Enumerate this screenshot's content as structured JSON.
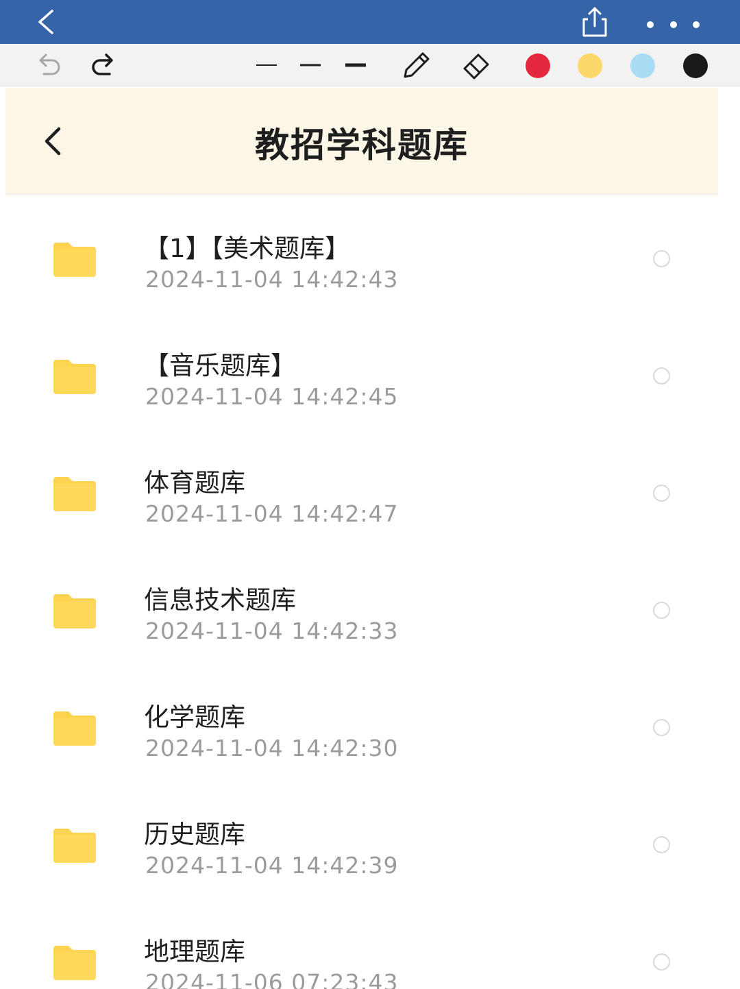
{
  "topbar": {
    "back_icon": "chevron-left-icon",
    "share_icon": "share-icon",
    "more_icon": "more-horizontal-icon",
    "bg_color": "#3565a8"
  },
  "toolbar": {
    "tools": [
      "undo-icon",
      "redo-icon",
      "thin-line-icon",
      "medium-line-icon",
      "thick-line-icon",
      "pencil-icon",
      "eraser-icon"
    ],
    "colors": [
      "#e5283d",
      "#fbd86a",
      "#a8dcf5",
      "#1a1a1a"
    ]
  },
  "page": {
    "title": "教招学科题库",
    "back_icon": "chevron-left-icon",
    "header_bg": "#fcf6e6"
  },
  "files": [
    {
      "name": "【1】【美术题库】",
      "date": "2024-11-04  14:42:43"
    },
    {
      "name": "【音乐题库】",
      "date": "2024-11-04  14:42:45"
    },
    {
      "name": "体育题库",
      "date": "2024-11-04  14:42:47"
    },
    {
      "name": "信息技术题库",
      "date": "2024-11-04  14:42:33"
    },
    {
      "name": "化学题库",
      "date": "2024-11-04  14:42:30"
    },
    {
      "name": "历史题库",
      "date": "2024-11-04  14:42:39"
    },
    {
      "name": "地理题库",
      "date": "2024-11-06  07:23:43"
    }
  ],
  "folder_color": "#fdd451"
}
